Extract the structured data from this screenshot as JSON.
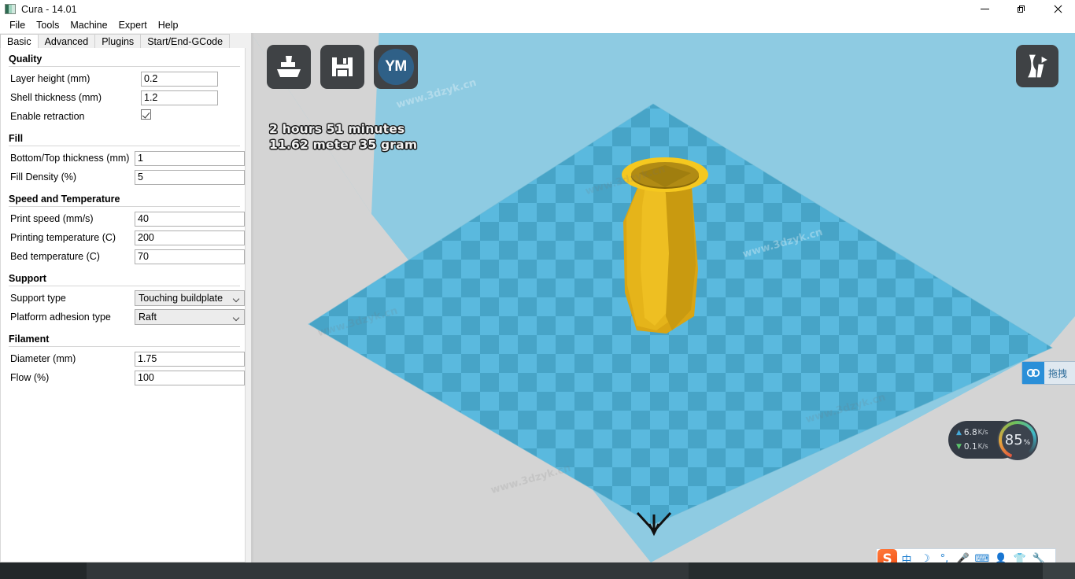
{
  "window": {
    "title": "Cura - 14.01",
    "app_icon": "cura-logo-icon",
    "minimize_label": "Minimize",
    "maximize_label": "Restore",
    "close_label": "Close"
  },
  "menubar": {
    "items": [
      {
        "label": "File",
        "name": "menu-file"
      },
      {
        "label": "Tools",
        "name": "menu-tools"
      },
      {
        "label": "Machine",
        "name": "menu-machine"
      },
      {
        "label": "Expert",
        "name": "menu-expert"
      },
      {
        "label": "Help",
        "name": "menu-help"
      }
    ]
  },
  "tabs": [
    {
      "label": "Basic",
      "active": true
    },
    {
      "label": "Advanced",
      "active": false
    },
    {
      "label": "Plugins",
      "active": false
    },
    {
      "label": "Start/End-GCode",
      "active": false
    }
  ],
  "settings": {
    "groups": [
      {
        "title": "Quality",
        "rows": [
          {
            "label": "Layer height (mm)",
            "value": "0.2",
            "type": "text"
          },
          {
            "label": "Shell thickness (mm)",
            "value": "1.2",
            "type": "text"
          },
          {
            "label": "Enable retraction",
            "value": "checked",
            "type": "checkbox"
          }
        ]
      },
      {
        "title": "Fill",
        "rows": [
          {
            "label": "Bottom/Top thickness (mm)",
            "value": "1",
            "type": "text"
          },
          {
            "label": "Fill Density (%)",
            "value": "5",
            "type": "text"
          }
        ]
      },
      {
        "title": "Speed and Temperature",
        "rows": [
          {
            "label": "Print speed (mm/s)",
            "value": "40",
            "type": "text"
          },
          {
            "label": "Printing temperature (C)",
            "value": "200",
            "type": "text"
          },
          {
            "label": "Bed temperature (C)",
            "value": "70",
            "type": "text"
          }
        ]
      },
      {
        "title": "Support",
        "rows": [
          {
            "label": "Support type",
            "value": "Touching buildplate",
            "type": "select"
          },
          {
            "label": "Platform adhesion type",
            "value": "Raft",
            "type": "select"
          }
        ]
      },
      {
        "title": "Filament",
        "rows": [
          {
            "label": "Diameter (mm)",
            "value": "1.75",
            "type": "text"
          },
          {
            "label": "Flow (%)",
            "value": "100",
            "type": "text"
          }
        ]
      }
    ]
  },
  "viewport": {
    "toolbar": [
      {
        "name": "load-model-button",
        "icon": "load-model-icon",
        "label": ""
      },
      {
        "name": "save-toolpath-button",
        "icon": "floppy-disk-icon",
        "label": ""
      },
      {
        "name": "youmagine-share-button",
        "icon": "youmagine-icon",
        "label": "YM"
      }
    ],
    "print_time": "2 hours 51 minutes",
    "print_material": "11.62 meter 35 gram",
    "viewmode_button": "view-mode-icon",
    "build_plate_front_marker": "front-arrow-icon",
    "colors": {
      "background": "#d4d4d4",
      "machine_volume": "#8ecbe2",
      "build_plate_light": "#5bb8dd",
      "build_plate_dark": "#4aa3c8",
      "model": "#e8b51c",
      "model_shadow": "#b08a10"
    }
  },
  "overlays": {
    "baidu_widget": {
      "label": "拖拽",
      "icon": "baidu-cloud-icon"
    },
    "network_monitor": {
      "upload": "6.8",
      "upload_unit": "K/s",
      "download": "0.1",
      "download_unit": "K/s",
      "gauge_value": "85",
      "gauge_unit": "%"
    },
    "ime_toolbar": {
      "logo": "S",
      "items": [
        {
          "glyph": "中",
          "name": "ime-language-toggle"
        },
        {
          "glyph": "☽",
          "name": "ime-moon-icon"
        },
        {
          "glyph": "°,",
          "name": "ime-punctuation-icon"
        },
        {
          "glyph": "🎤",
          "name": "ime-microphone-icon"
        },
        {
          "glyph": "⌨",
          "name": "ime-keyboard-icon"
        },
        {
          "glyph": "👤",
          "name": "ime-user-icon"
        },
        {
          "glyph": "👕",
          "name": "ime-skin-icon"
        },
        {
          "glyph": "🔧",
          "name": "ime-toolbox-icon"
        }
      ]
    }
  },
  "watermarks": {
    "text": "www.3dzyk.cn"
  }
}
